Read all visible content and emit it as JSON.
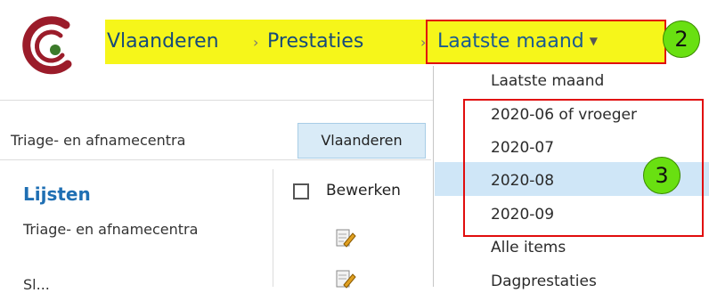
{
  "breadcrumb": {
    "items": [
      "Vlaanderen",
      "Prestaties"
    ],
    "current_dropdown": "Laatste maand",
    "separator_icon": "chevron-right-icon",
    "highlight_color": "#f6f61a"
  },
  "markers": {
    "step_2": "2",
    "step_3": "3",
    "color": "#69e011",
    "outline_color": "#e10d0d"
  },
  "tabs": [
    {
      "label": "Triage- en afnamecentra",
      "selected": false
    },
    {
      "label": "Vlaanderen",
      "selected": true
    }
  ],
  "left_nav": {
    "title": "Lijsten",
    "items": [
      "Triage- en afnamecentra",
      "Sl..."
    ]
  },
  "list_toolbar": {
    "edit_label": "Bewerken"
  },
  "dropdown_menu": {
    "items": [
      "Laatste maand",
      "2020-06 of vroeger",
      "2020-07",
      "2020-08",
      "2020-09",
      "Alle items",
      "Dagprestaties"
    ],
    "hovered": "2020-08"
  }
}
